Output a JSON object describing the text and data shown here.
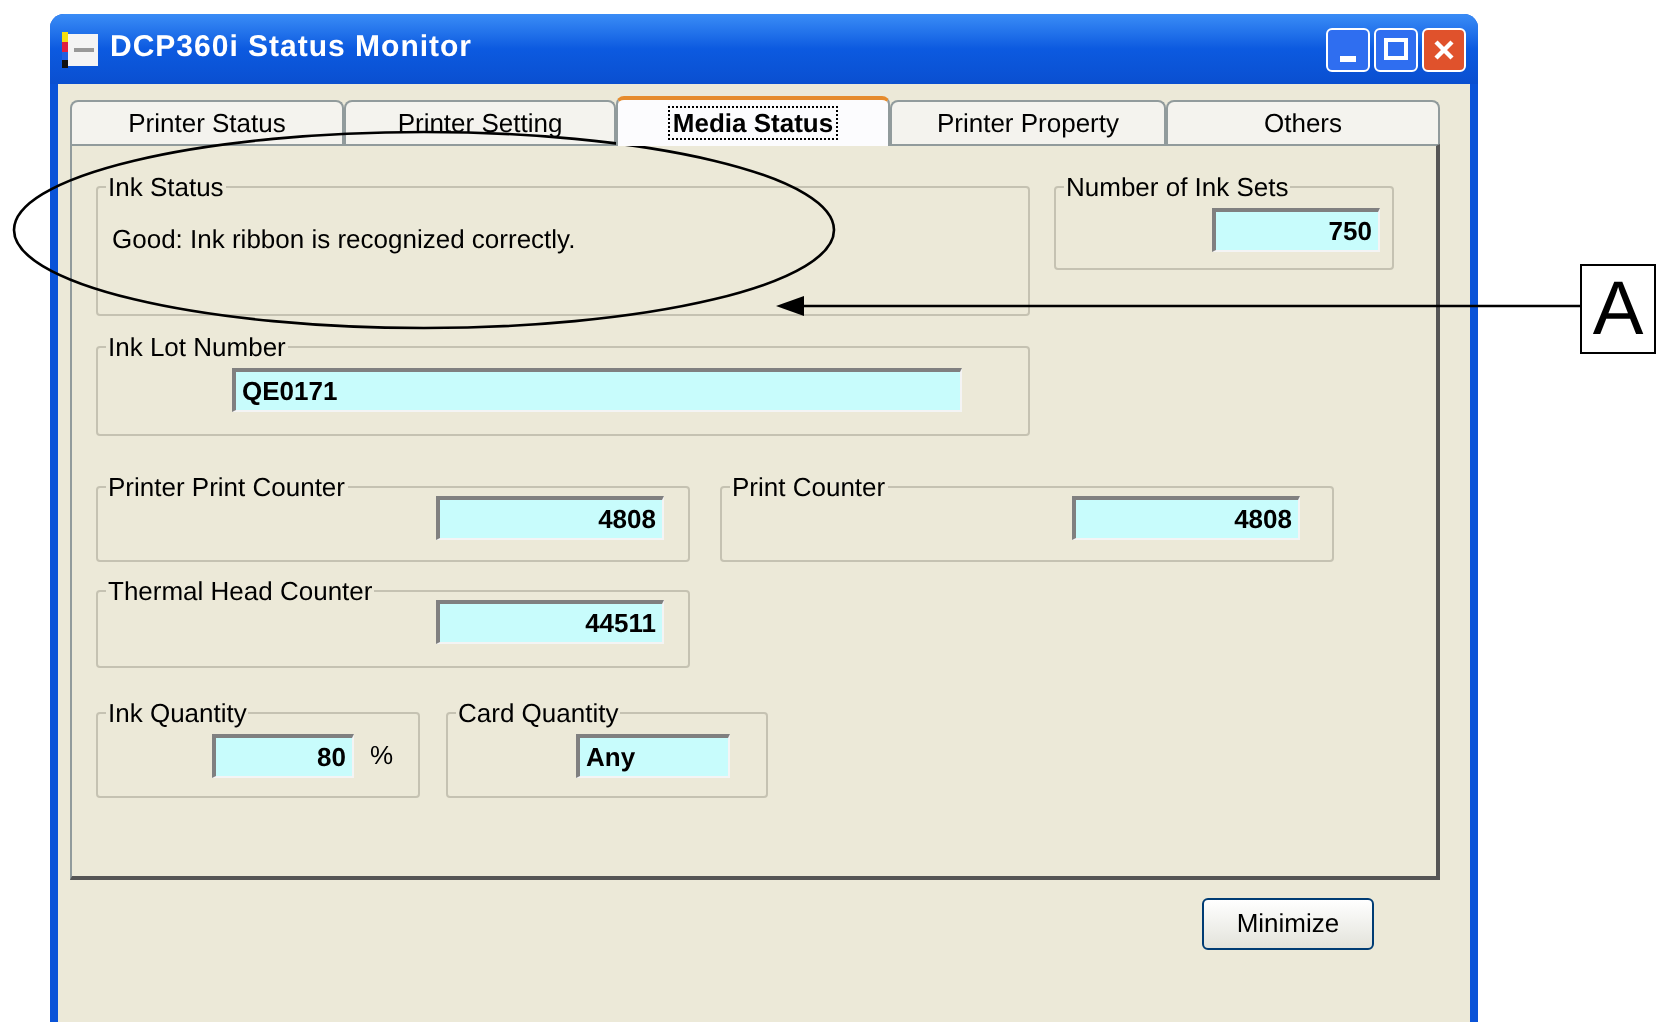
{
  "window": {
    "title": "DCP360i Status Monitor"
  },
  "tabs": [
    {
      "label": "Printer Status",
      "selected": false
    },
    {
      "label": "Printer Setting",
      "selected": false
    },
    {
      "label": "Media Status",
      "selected": true
    },
    {
      "label": "Printer Property",
      "selected": false
    },
    {
      "label": "Others",
      "selected": false
    }
  ],
  "ink_status": {
    "label": "Ink Status",
    "message": "Good: Ink ribbon is recognized correctly."
  },
  "number_of_ink_sets": {
    "label": "Number of Ink Sets",
    "value": "750"
  },
  "ink_lot_number": {
    "label": "Ink Lot Number",
    "value": "QE0171"
  },
  "printer_print_counter": {
    "label": "Printer Print Counter",
    "value": "4808"
  },
  "print_counter": {
    "label": "Print Counter",
    "value": "4808"
  },
  "thermal_head_counter": {
    "label": "Thermal Head Counter",
    "value": "44511"
  },
  "ink_quantity": {
    "label": "Ink Quantity",
    "value": "80",
    "unit": "%"
  },
  "card_quantity": {
    "label": "Card Quantity",
    "value": "Any"
  },
  "buttons": [
    "Minimize"
  ],
  "callout": {
    "label": "A"
  }
}
